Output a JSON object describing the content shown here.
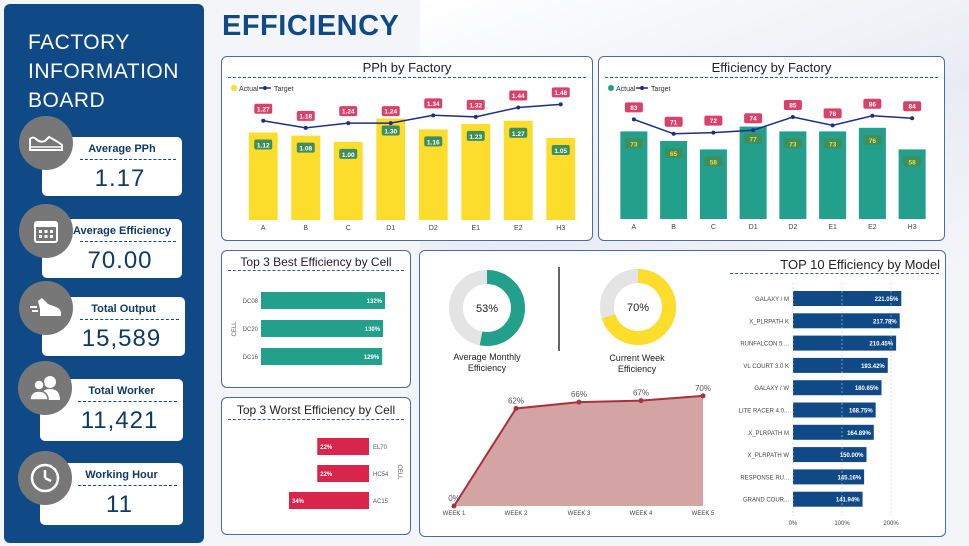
{
  "sidebar": {
    "title_lines": [
      "FACTORY",
      "INFORMATION",
      "BOARD"
    ],
    "kpis": [
      {
        "label": "Average PPh",
        "value": "1.17",
        "icon": "shoe-icon"
      },
      {
        "label": "Average Efficiency",
        "value": "70.00",
        "icon": "calendar-icon"
      },
      {
        "label": "Total Output",
        "value": "15,589",
        "icon": "running-shoe-icon"
      },
      {
        "label": "Total Worker",
        "value": "11,421",
        "icon": "people-icon"
      },
      {
        "label": "Working Hour",
        "value": "11",
        "icon": "clock-icon"
      }
    ]
  },
  "page_title": "EFFICIENCY",
  "colors": {
    "navy": "#0f4a86",
    "yellow": "#fddd2b",
    "teal": "#22a08c",
    "pink": "#d9254c",
    "target_line": "#1c2d8a",
    "area_fill": "#d4a3a4",
    "area_line": "#a8323c"
  },
  "chart_data": [
    {
      "id": "pph",
      "type": "bar",
      "title": "PPh by Factory",
      "legend": [
        "Actual",
        "Target"
      ],
      "legend_position": "top-left",
      "categories": [
        "A",
        "B",
        "C",
        "D1",
        "D2",
        "E1",
        "E2",
        "H3"
      ],
      "series": [
        {
          "name": "Actual",
          "values": [
            1.12,
            1.08,
            1.0,
            1.3,
            1.16,
            1.23,
            1.27,
            1.05
          ]
        },
        {
          "name": "Target",
          "values": [
            1.27,
            1.18,
            1.24,
            1.24,
            1.34,
            1.32,
            1.44,
            1.48
          ]
        }
      ],
      "ylim": [
        0,
        1.6
      ]
    },
    {
      "id": "eff_factory",
      "type": "bar",
      "title": "Efficiency by Factory",
      "legend": [
        "Actual",
        "Target"
      ],
      "legend_position": "top-left",
      "categories": [
        "A",
        "B",
        "C",
        "D1",
        "D2",
        "E1",
        "E2",
        "H3"
      ],
      "series": [
        {
          "name": "Actual",
          "values": [
            73,
            65,
            58,
            77,
            73,
            73,
            76,
            58
          ]
        },
        {
          "name": "Target",
          "values": [
            83,
            71,
            72,
            74,
            85,
            78,
            86,
            84
          ]
        }
      ],
      "ylim": [
        0,
        100
      ]
    },
    {
      "id": "best_cell",
      "type": "bar",
      "orientation": "horizontal",
      "title": "Top 3 Best Efficiency by Cell",
      "ylabel": "CELL",
      "categories": [
        "DC08",
        "DC20",
        "DC16"
      ],
      "values": [
        132,
        130,
        129
      ],
      "value_labels": [
        "132%",
        "130%",
        "129%"
      ]
    },
    {
      "id": "worst_cell",
      "type": "bar",
      "orientation": "horizontal",
      "title": "Top 3 Worst Efficiency by Cell",
      "ylabel": "CELL",
      "categories": [
        "EL70",
        "HC54",
        "AC15"
      ],
      "values": [
        22,
        22,
        34
      ],
      "value_labels": [
        "22%",
        "22%",
        "34%"
      ]
    },
    {
      "id": "avg_monthly",
      "type": "pie",
      "title": "Average Monthly Efficiency",
      "value": 53,
      "label": "53%"
    },
    {
      "id": "current_week",
      "type": "pie",
      "title": "Current Week Efficiency",
      "value": 70,
      "label": "70%"
    },
    {
      "id": "weekly",
      "type": "area",
      "categories": [
        "WEEK 1",
        "WEEK 2",
        "WEEK 3",
        "WEEK 4",
        "WEEK 5"
      ],
      "values": [
        0,
        62,
        66,
        67,
        70
      ],
      "value_labels": [
        "0%",
        "62%",
        "66%",
        "67%",
        "70%"
      ],
      "ylim": [
        0,
        75
      ]
    },
    {
      "id": "top10_model",
      "type": "bar",
      "orientation": "horizontal",
      "title": "TOP 10 Efficiency by Model",
      "categories": [
        "GALAXY / M",
        "X_PLRPATH K",
        "RUNFALCON 5 ...",
        "VL COURT 3.0 K",
        "GALAXY / W",
        "LITE RACER 4.0...",
        "X_PLRPATH M",
        "X_PLRPATH W",
        "RESPONSE RU...",
        "GRAND COUR..."
      ],
      "values": [
        221.05,
        217.78,
        210.45,
        193.42,
        180.65,
        168.75,
        164.89,
        150.0,
        145.16,
        141.94
      ],
      "value_labels": [
        "221.05%",
        "217.78%",
        "210.45%",
        "193.42%",
        "180.65%",
        "168.75%",
        "164.89%",
        "150.00%",
        "145.16%",
        "141.94%"
      ],
      "xticks": [
        "0%",
        "100%",
        "200%"
      ],
      "xlim": [
        0,
        240
      ]
    }
  ]
}
